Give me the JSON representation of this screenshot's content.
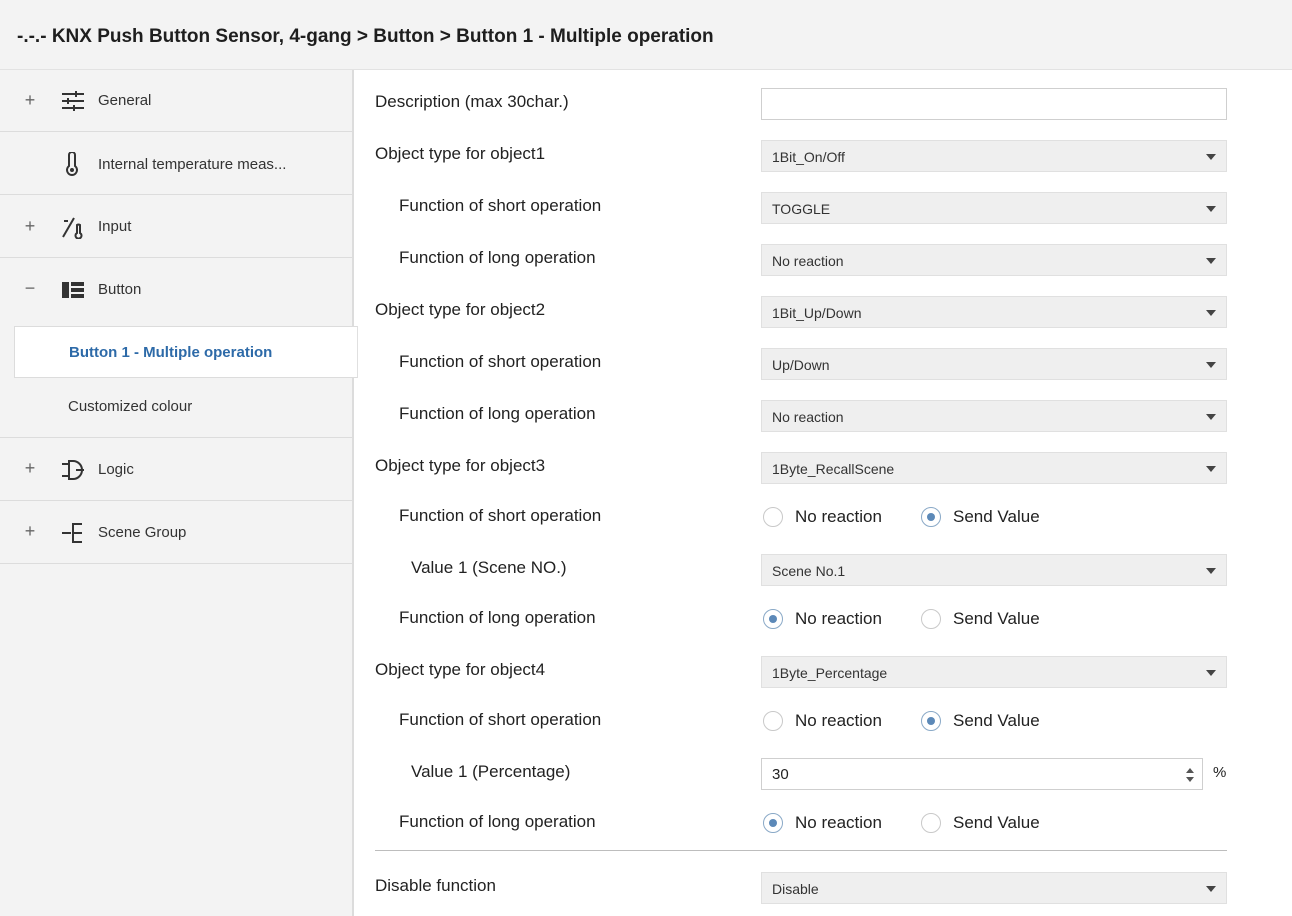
{
  "window": {
    "title": "-.-.- KNX Push Button Sensor, 4-gang > Button > Button 1 - Multiple operation"
  },
  "sidebar": {
    "items": [
      {
        "label": "General",
        "expander": "+",
        "icon": "sliders-icon"
      },
      {
        "label": "Internal temperature meas...",
        "expander": "",
        "icon": "thermometer-icon"
      },
      {
        "label": "Input",
        "expander": "+",
        "icon": "input-icon"
      },
      {
        "label": "Button",
        "expander": "−",
        "icon": "button-icon"
      },
      {
        "label": "Button 1 - Multiple operation",
        "selected": true
      },
      {
        "label": "Customized colour"
      },
      {
        "label": "Logic",
        "expander": "+",
        "icon": "logic-icon"
      },
      {
        "label": "Scene Group",
        "expander": "+",
        "icon": "scene-group-icon"
      }
    ]
  },
  "form": {
    "description": {
      "label": "Description (max 30char.)",
      "value": ""
    },
    "obj1": {
      "label": "Object type for object1",
      "value": "1Bit_On/Off"
    },
    "obj1_short": {
      "label": "Function of short operation",
      "value": "TOGGLE"
    },
    "obj1_long": {
      "label": "Function of long operation",
      "value": "No reaction"
    },
    "obj2": {
      "label": "Object type for object2",
      "value": "1Bit_Up/Down"
    },
    "obj2_short": {
      "label": "Function of short operation",
      "value": "Up/Down"
    },
    "obj2_long": {
      "label": "Function of long operation",
      "value": "No reaction"
    },
    "obj3": {
      "label": "Object type for object3",
      "value": "1Byte_RecallScene"
    },
    "obj3_short": {
      "label": "Function of short operation",
      "options": [
        "No reaction",
        "Send Value"
      ],
      "selected": "Send Value"
    },
    "obj3_value1": {
      "label": "Value 1 (Scene NO.)",
      "value": "Scene No.1"
    },
    "obj3_long": {
      "label": "Function of long operation",
      "options": [
        "No reaction",
        "Send Value"
      ],
      "selected": "No reaction"
    },
    "obj4": {
      "label": "Object type for object4",
      "value": "1Byte_Percentage"
    },
    "obj4_short": {
      "label": "Function of short operation",
      "options": [
        "No reaction",
        "Send Value"
      ],
      "selected": "Send Value"
    },
    "obj4_value1": {
      "label": "Value 1 (Percentage)",
      "value": "30",
      "unit": "%"
    },
    "obj4_long": {
      "label": "Function of long operation",
      "options": [
        "No reaction",
        "Send Value"
      ],
      "selected": "No reaction"
    },
    "disable": {
      "label": "Disable function",
      "value": "Disable"
    }
  },
  "colors": {
    "accent": "#2d6aa8",
    "radio_selected": "#5c89b8",
    "sidebar_bg": "#f3f3f3"
  }
}
